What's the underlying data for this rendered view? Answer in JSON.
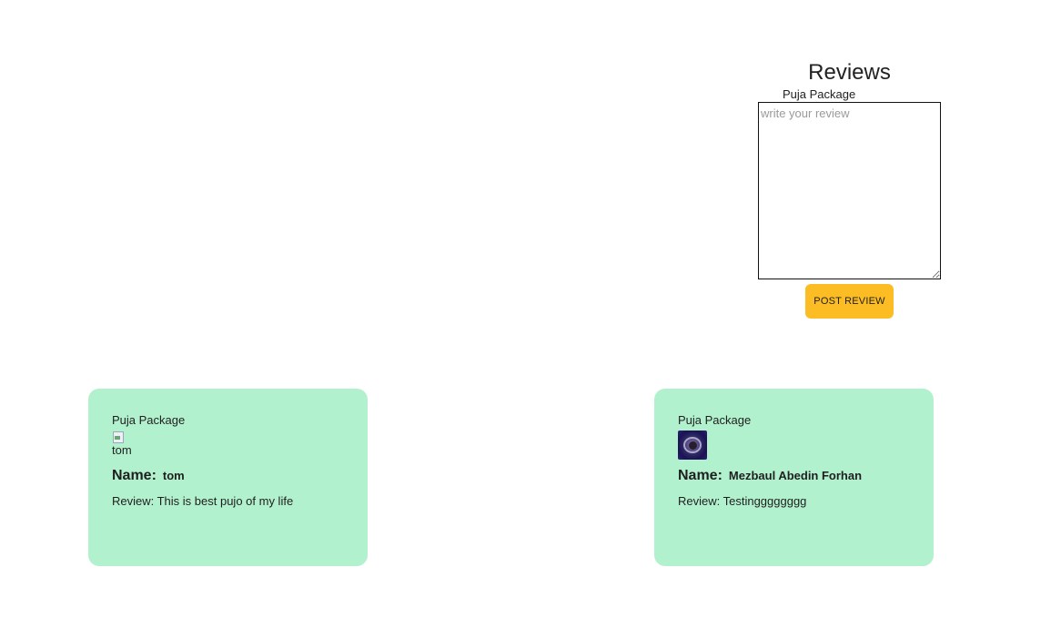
{
  "form": {
    "heading": "Reviews",
    "package_label": "Puja Package",
    "textarea_placeholder": "write your review",
    "submit_label": "POST REVIEW",
    "submit_color": "#fbbd23"
  },
  "cards": [
    {
      "package": "Puja Package",
      "avatar_alt": "tom",
      "avatar_icon": "broken-image-icon",
      "name_label": "Name:",
      "name": "tom",
      "review": "Review: This is best pujo of my life"
    },
    {
      "package": "Puja Package",
      "avatar_icon": "user-avatar",
      "name_label": "Name:",
      "name": "Mezbaul Abedin Forhan",
      "review": "Review: Testingggggggg"
    }
  ],
  "card_color": "#b2f1ce"
}
